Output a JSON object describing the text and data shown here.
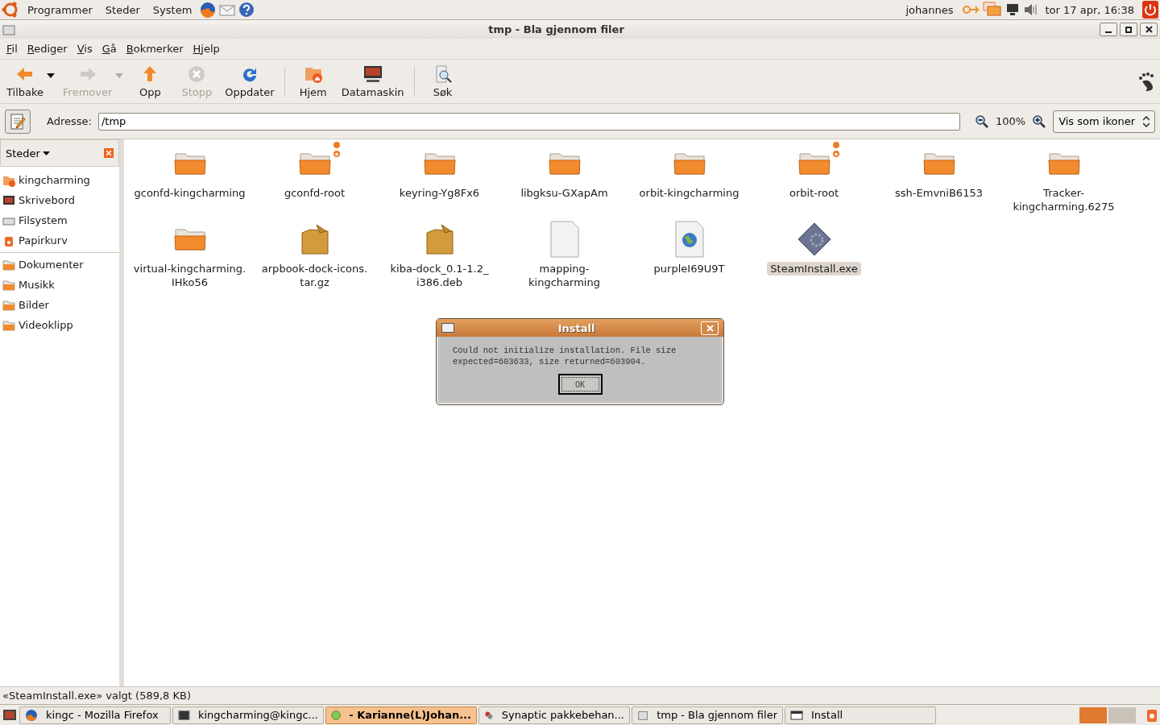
{
  "top_panel": {
    "menus": [
      "Programmer",
      "Steder",
      "System"
    ],
    "user": "johannes",
    "clock": "tor 17 apr, 16:38"
  },
  "window": {
    "title": "tmp - Bla gjennom filer"
  },
  "menubar": [
    "Fil",
    "Rediger",
    "Vis",
    "Gå",
    "Bokmerker",
    "Hjelp"
  ],
  "toolbar": [
    {
      "label": "Tilbake",
      "kind": "back",
      "disabled": false,
      "dropdown": true
    },
    {
      "label": "Fremover",
      "kind": "forward",
      "disabled": true,
      "dropdown": true
    },
    {
      "label": "Opp",
      "kind": "up",
      "disabled": false,
      "dropdown": false
    },
    {
      "label": "Stopp",
      "kind": "stop",
      "disabled": true,
      "dropdown": false
    },
    {
      "label": "Oppdater",
      "kind": "reload",
      "disabled": false,
      "dropdown": false,
      "separator_after": true
    },
    {
      "label": "Hjem",
      "kind": "home",
      "disabled": false,
      "dropdown": false
    },
    {
      "label": "Datamaskin",
      "kind": "computer",
      "disabled": false,
      "dropdown": false,
      "separator_after": true
    },
    {
      "label": "Søk",
      "kind": "search",
      "disabled": false,
      "dropdown": false
    }
  ],
  "location": {
    "label": "Adresse:",
    "value": "/tmp",
    "zoom": "100%",
    "view": "Vis som ikoner"
  },
  "sidebar": {
    "title": "Steder",
    "groups": [
      [
        {
          "label": "kingcharming",
          "kind": "home"
        },
        {
          "label": "Skrivebord",
          "kind": "desktop"
        },
        {
          "label": "Filsystem",
          "kind": "drive"
        },
        {
          "label": "Papirkurv",
          "kind": "trash"
        }
      ],
      [
        {
          "label": "Dokumenter",
          "kind": "folder"
        },
        {
          "label": "Musikk",
          "kind": "folder"
        },
        {
          "label": "Bilder",
          "kind": "folder"
        },
        {
          "label": "Videoklipp",
          "kind": "folder"
        }
      ]
    ]
  },
  "files": [
    {
      "name": "gconfd-kingcharming",
      "kind": "folder",
      "locked": false,
      "selected": false
    },
    {
      "name": "gconfd-root",
      "kind": "folder",
      "locked": true,
      "selected": false
    },
    {
      "name": "keyring-Yg8Fx6",
      "kind": "folder",
      "locked": false,
      "selected": false
    },
    {
      "name": "libgksu-GXapAm",
      "kind": "folder",
      "locked": false,
      "selected": false
    },
    {
      "name": "orbit-kingcharming",
      "kind": "folder",
      "locked": false,
      "selected": false
    },
    {
      "name": "orbit-root",
      "kind": "folder",
      "locked": true,
      "selected": false
    },
    {
      "name": "ssh-EmvniB6153",
      "kind": "folder",
      "locked": false,
      "selected": false
    },
    {
      "name": "Tracker-\nkingcharming.6275",
      "kind": "folder",
      "locked": false,
      "selected": false
    },
    {
      "name": "virtual-kingcharming.\nIHko56",
      "kind": "folder",
      "locked": false,
      "selected": false
    },
    {
      "name": "arpbook-dock-icons.\ntar.gz",
      "kind": "package",
      "locked": false,
      "selected": false
    },
    {
      "name": "kiba-dock_0.1-1.2_\ni386.deb",
      "kind": "package",
      "locked": false,
      "selected": false
    },
    {
      "name": "mapping-\nkingcharming",
      "kind": "blank",
      "locked": false,
      "selected": false
    },
    {
      "name": "purpleI69U9T",
      "kind": "web",
      "locked": false,
      "selected": false
    },
    {
      "name": "SteamInstall.exe",
      "kind": "exe",
      "locked": false,
      "selected": true
    }
  ],
  "dialog": {
    "title": "Install",
    "message": "Could not initialize installation. File size\nexpected=603633, size returned=603904.",
    "button": "OK"
  },
  "status_bar": "«SteamInstall.exe» valgt (589,8 KB)",
  "taskbar": [
    {
      "label": "kingc - Mozilla Firefox",
      "kind": "firefox",
      "selected": false
    },
    {
      "label": "kingcharming@kingc...",
      "kind": "terminal",
      "selected": false
    },
    {
      "label": "- Karianne(L)Johan...",
      "kind": "chat",
      "selected": true
    },
    {
      "label": "Synaptic pakkebehan...",
      "kind": "synaptic",
      "selected": false
    },
    {
      "label": "tmp - Bla gjennom filer",
      "kind": "files",
      "selected": false
    },
    {
      "label": "Install",
      "kind": "window",
      "selected": false
    }
  ]
}
